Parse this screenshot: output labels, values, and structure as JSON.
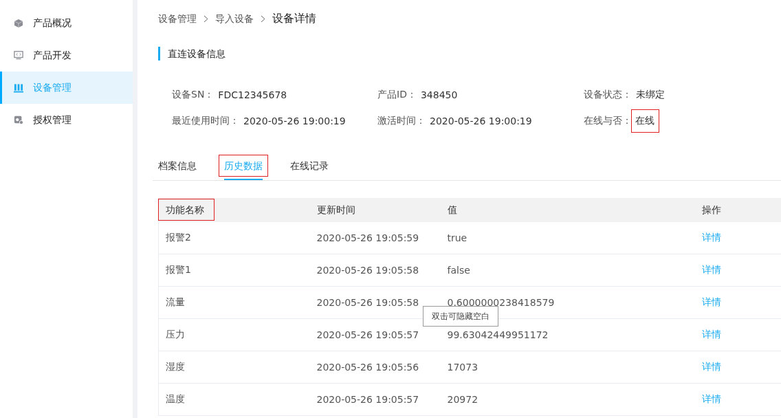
{
  "sidebar": {
    "items": [
      {
        "label": "产品概况",
        "selected": false
      },
      {
        "label": "产品开发",
        "selected": false
      },
      {
        "label": "设备管理",
        "selected": true
      },
      {
        "label": "授权管理",
        "selected": false
      }
    ]
  },
  "breadcrumb": [
    {
      "label": "设备管理",
      "current": false
    },
    {
      "label": "导入设备",
      "current": false
    },
    {
      "label": "设备详情",
      "current": true
    }
  ],
  "section_title": "直连设备信息",
  "info_fields": [
    {
      "label": "设备SN：",
      "value": "FDC12345678",
      "highlighted": false
    },
    {
      "label": "产品ID：",
      "value": "348450",
      "highlighted": false
    },
    {
      "label": "设备状态：",
      "value": "未绑定",
      "highlighted": false
    },
    {
      "label": "最近使用时间：",
      "value": "2020-05-26 19:00:19",
      "highlighted": false
    },
    {
      "label": "激活时间：",
      "value": "2020-05-26 19:00:19",
      "highlighted": false
    },
    {
      "label": "在线与否：",
      "value": "在线",
      "highlighted": true
    }
  ],
  "tabs": [
    {
      "label": "档案信息",
      "selected": false,
      "highlighted": false
    },
    {
      "label": "历史数据",
      "selected": true,
      "highlighted": true
    },
    {
      "label": "在线记录",
      "selected": false,
      "highlighted": false
    }
  ],
  "table": {
    "columns": [
      {
        "label": "功能名称",
        "highlighted": true
      },
      {
        "label": "更新时间",
        "highlighted": false
      },
      {
        "label": "值",
        "highlighted": false
      },
      {
        "label": "操作",
        "highlighted": false
      }
    ],
    "rows": [
      {
        "cells": [
          "报警2",
          "2020-05-26 19:05:59",
          "true"
        ],
        "action": "详情"
      },
      {
        "cells": [
          "报警1",
          "2020-05-26 19:05:58",
          "false"
        ],
        "action": "详情"
      },
      {
        "cells": [
          "流量",
          "2020-05-26 19:05:58",
          "0.6000000238418579"
        ],
        "action": "详情"
      },
      {
        "cells": [
          "压力",
          "2020-05-26 19:05:57",
          "99.63042449951172"
        ],
        "action": "详情"
      },
      {
        "cells": [
          "湿度",
          "2020-05-26 19:05:56",
          "17073"
        ],
        "action": "详情"
      },
      {
        "cells": [
          "温度",
          "2020-05-26 19:05:57",
          "20972"
        ],
        "action": "详情"
      }
    ]
  },
  "tooltip": "双击可隐藏空白"
}
